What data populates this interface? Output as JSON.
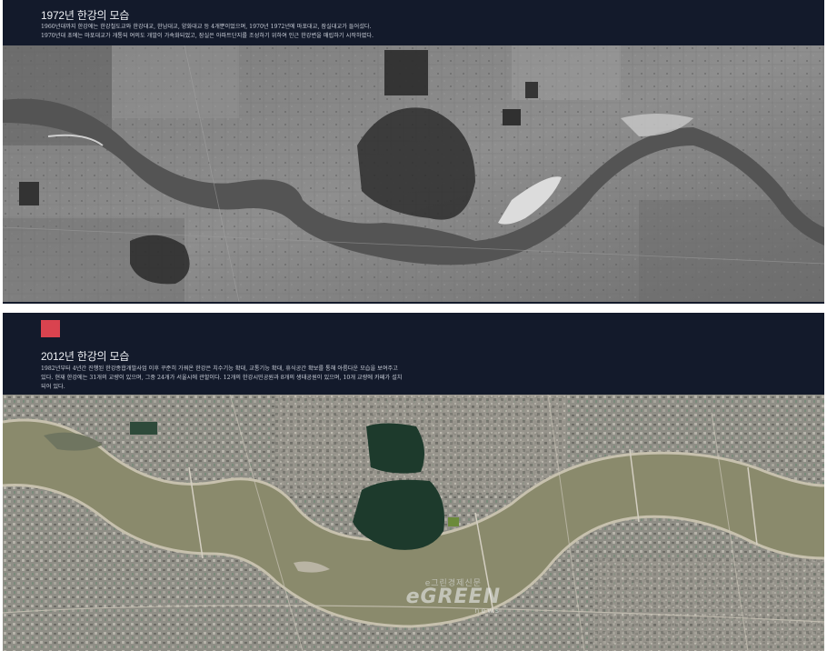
{
  "panel_1972": {
    "title": "1972년 한강의 모습",
    "description": "1960년대까지 한강에는 한강철도교와 한강대교, 한남대교, 양화대교 등 4개뿐이었으며, 1970년 1972년에 마포대교, 잠실대교가 들어섰다.\n1970년대 초에는 마포대교가 개통되 여의도 개발이 가속화되었고, 잠실은 아파트단지를 조성하기 위하여 인근 한강변을 매립하기 시작하였다."
  },
  "panel_2012": {
    "accent_color": "#d9434f",
    "title": "2012년 한강의 모습",
    "description": "1982년부터 4년간 진행된 한강종합개발사업 이후 꾸준히 가꿔온 한강은 치수기능 확대, 교통기능 확대, 휴식공간 확보를 통해 아름다운 모습을 보여주고\n있다. 현재 한강에는 31개의 교량이 있으며, 그중 24개가 서울시에 관할이다. 12개의 한강시민공원과 8개의 생태공원이 있으며, 10개 교량에 카페가 설치\n되어 있다."
  },
  "watermark": {
    "top": "e그린경제신문",
    "main": "eGREEN",
    "sub": "news"
  },
  "colors": {
    "panel_background": "#131a2b",
    "river_2012": "#8a8a6c",
    "park_green": "#1d3a2c"
  }
}
